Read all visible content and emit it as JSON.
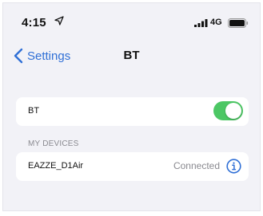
{
  "status_bar": {
    "time": "4:15",
    "network": "4G",
    "icons": [
      "location-arrow-icon",
      "cellular-signal-icon",
      "battery-icon"
    ]
  },
  "nav": {
    "back_label": "Settings",
    "title": "BT",
    "back_icon": "chevron-left-icon"
  },
  "bluetooth": {
    "label": "BT",
    "enabled": true
  },
  "my_devices": {
    "header": "MY DEVICES",
    "items": [
      {
        "name": "EAZZE_D1Air",
        "status": "Connected",
        "icon": "info-icon"
      }
    ]
  },
  "colors": {
    "accent": "#2f6fd6",
    "toggle_on": "#4cc764",
    "background": "#f2f2f7",
    "secondary_text": "#8a8a90"
  }
}
